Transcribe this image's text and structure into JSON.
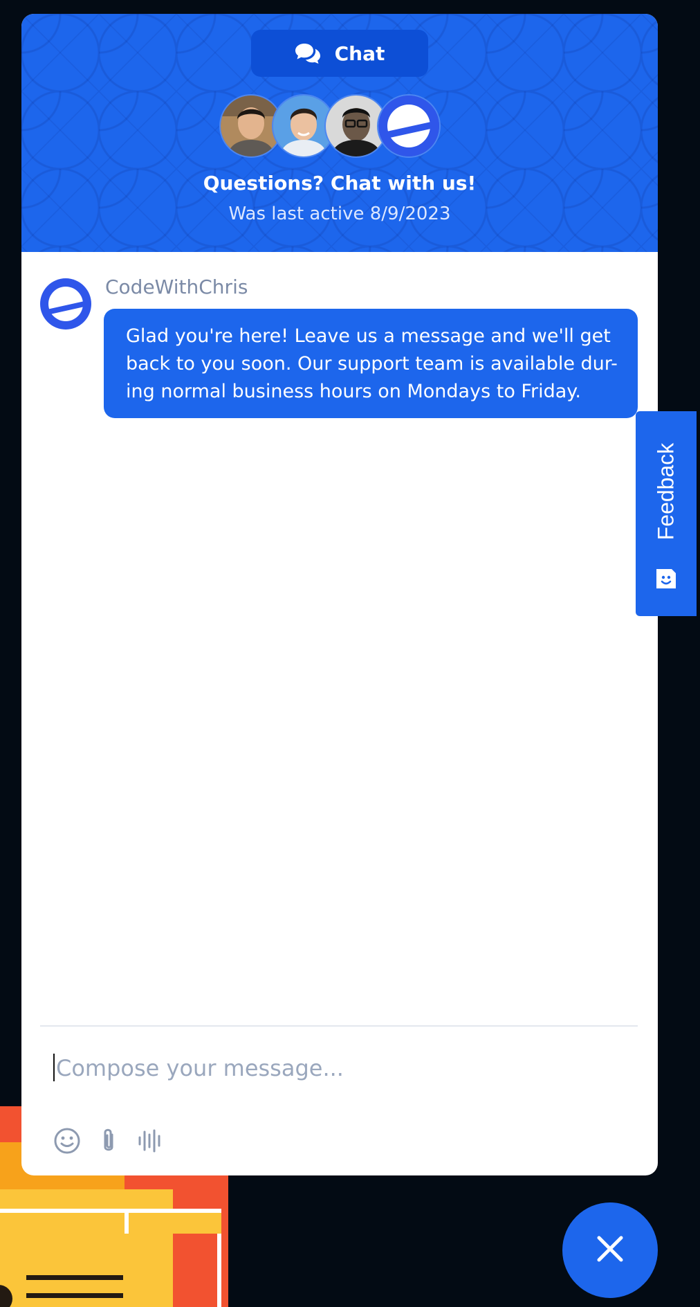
{
  "header": {
    "tab_label": "Chat",
    "title": "Questions? Chat with us!",
    "status": "Was last active 8/9/2023",
    "avatars": [
      "agent-avatar-1",
      "agent-avatar-2",
      "agent-avatar-3",
      "brand-logo-avatar"
    ]
  },
  "message": {
    "sender": "CodeWithChris",
    "lines": [
      "Glad you're here! Leave us a message and we'll get",
      "back to you soon. Our support team is available dur-",
      "ing normal business hours on Mondays to Friday."
    ]
  },
  "composer": {
    "placeholder": "Compose your message...",
    "value": "",
    "tools": [
      "emoji-icon",
      "paperclip-icon",
      "voice-icon"
    ]
  },
  "feedback": {
    "label": "Feedback",
    "icon": "smiley-icon"
  },
  "close_button": {
    "icon": "close-icon"
  },
  "colors": {
    "accent": "#1d66ec",
    "accent_dark": "#0d4fd6",
    "page_background": "#030b14",
    "sender_text": "#7b8aa6",
    "placeholder_text": "#9aa7bd"
  }
}
